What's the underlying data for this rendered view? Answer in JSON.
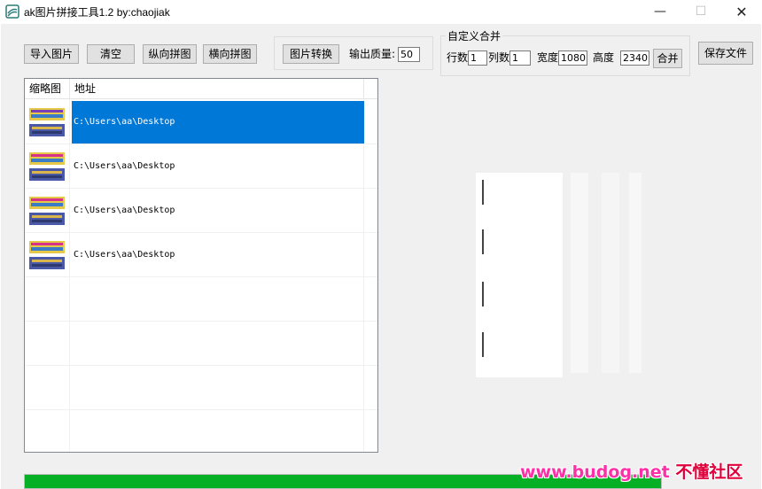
{
  "window": {
    "title": "ak图片拼接工具1.2   by:chaojiak",
    "minimize_glyph": "—",
    "maximize_glyph": "☐",
    "close_glyph": "✕"
  },
  "toolbar": {
    "import_label": "导入图片",
    "clear_label": "清空",
    "vertical_label": "纵向拼图",
    "horizontal_label": "横向拼图",
    "convert_label": "图片转换",
    "quality_label": "输出质量:",
    "quality_value": "50",
    "save_label": "保存文件"
  },
  "custom_merge": {
    "legend": "自定义合并",
    "rows_label": "行数",
    "rows_value": "1",
    "cols_label": "列数",
    "cols_value": "1",
    "width_label": "宽度",
    "width_value": "1080",
    "height_label": "高度",
    "height_value": "2340",
    "merge_label": "合并"
  },
  "list": {
    "columns": [
      "缩略图",
      "地址"
    ],
    "rows": [
      {
        "path": "C:\\Users\\aa\\Desktop",
        "selected": true
      },
      {
        "path": "C:\\Users\\aa\\Desktop",
        "selected": false
      },
      {
        "path": "C:\\Users\\aa\\Desktop",
        "selected": false
      },
      {
        "path": "C:\\Users\\aa\\Desktop",
        "selected": false
      }
    ]
  },
  "progress": {
    "fraction": 1.0
  },
  "watermark": {
    "site": "www.budog.net",
    "name": "不懂社区"
  },
  "colors": {
    "selection": "#0078d7",
    "progress": "#06b025",
    "watermark": "#ff2fa8"
  },
  "icons": {
    "app": "app-logo-icon"
  }
}
